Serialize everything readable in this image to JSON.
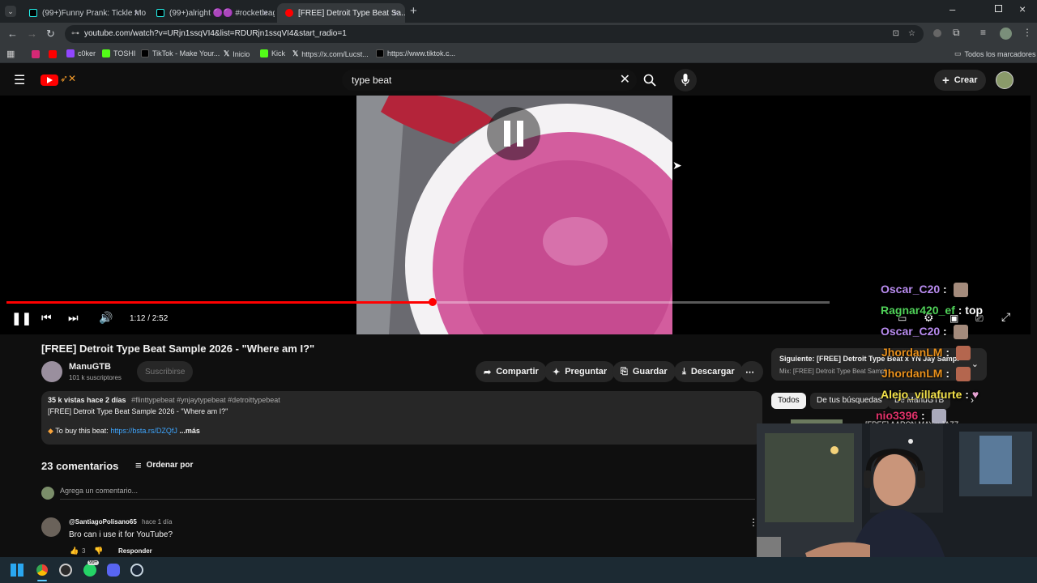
{
  "tabs": [
    {
      "title": "(99+)Funny Prank: Tickle Monst...",
      "icon": "tiktok-icon"
    },
    {
      "title": "(99+)alright 🟣🟣 #rocketleag...",
      "icon": "tiktok-icon"
    },
    {
      "title": "[FREE] Detroit Type Beat Sa...",
      "icon": "youtube-icon"
    }
  ],
  "address": "youtube.com/watch?v=URjn1ssqVI4&list=RDURjn1ssqVI4&start_radio=1",
  "bookmarks": [
    "c0ker",
    "TOSHI",
    "TikTok - Make Your...",
    "Inicio",
    "Kick",
    "https://x.com/Lucst...",
    "https://www.tiktok.c..."
  ],
  "bookmarks_all": "Todos los marcadores",
  "search": {
    "query": "type beat"
  },
  "create_label": "Crear",
  "player": {
    "time": "1:12 / 2:52",
    "progress_fraction": 0.518
  },
  "chat": [
    {
      "user": "Oscar_C20",
      "text": "",
      "color": "#b98cf0"
    },
    {
      "user": "Ragnar420_ef",
      "text": "top",
      "color": "#4fd158"
    },
    {
      "user": "Oscar_C20",
      "text": "",
      "color": "#b98cf0"
    },
    {
      "user": "JhordanLM",
      "text": "",
      "color": "#e8901c"
    },
    {
      "user": "JhordanLM",
      "text": "",
      "color": "#e8901c"
    },
    {
      "user": "Alejo_villafurte",
      "text": "",
      "color": "#f4e34a"
    },
    {
      "user": "nio3396",
      "text": "",
      "color": "#e2336b"
    }
  ],
  "video": {
    "title": "[FREE] Detroit Type Beat Sample 2026 - \"Where am I?\"",
    "channel": "ManuGTB",
    "subs": "101 k suscriptores",
    "subscribe": "Suscribirse"
  },
  "actions": [
    "Compartir",
    "Preguntar",
    "Guardar",
    "Descargar"
  ],
  "description": {
    "stats": "35 k vistas  hace 2 días",
    "tags": "#flinttypebeat #ynjaytypebeat #detroittypebeat",
    "line1": "[FREE] Detroit Type Beat Sample 2026 - \"Where am I?\"",
    "buy_prefix": "To buy this beat:",
    "link": "https://bsta.rs/DZQfJ",
    "more": "...más"
  },
  "comments": {
    "count": "23 comentarios",
    "sort": "Ordenar por",
    "placeholder": "Agrega un comentario...",
    "items": [
      {
        "author": "@SantiagoPolisano65",
        "time": "hace 1 día",
        "text": "Bro can i use it for YouTube?",
        "likes": "3",
        "reply": "Responder"
      }
    ]
  },
  "next_up": {
    "label": "Siguiente: [FREE] Detroit Type Beat x YN Jay Sampl...",
    "sub": "Mix: [FREE] Detroit Type Beat Sampl..."
  },
  "filter_chips": [
    "Todos",
    "De tus búsquedas",
    "De ManuGTB"
  ],
  "rec_partial": "[FREE] AARON MAY x JAZZ..."
}
